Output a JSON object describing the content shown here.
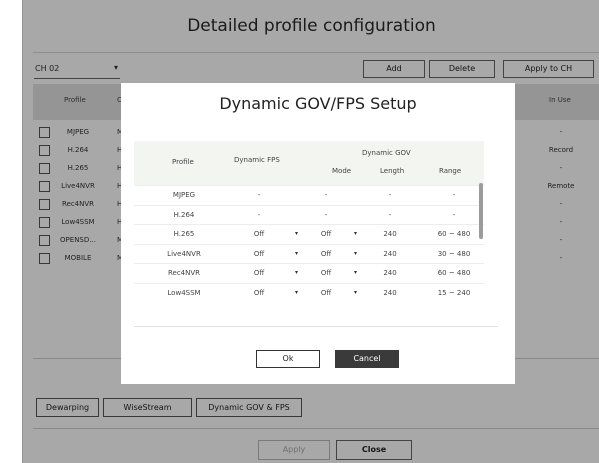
{
  "page": {
    "title": "Detailed profile configuration",
    "channel_select": {
      "value": "CH 02",
      "caret": "▾"
    },
    "toolbar": {
      "add": "Add",
      "delete": "Delete",
      "apply_to_ch": "Apply to CH"
    },
    "table": {
      "headers": {
        "profile": "Profile",
        "codec": "Co",
        "in_use": "In Use"
      },
      "rows": [
        {
          "profile": "MJPEG",
          "codec": "MJ",
          "in_use": "-"
        },
        {
          "profile": "H.264",
          "codec": "H.",
          "in_use": "Record"
        },
        {
          "profile": "H.265",
          "codec": "H.",
          "in_use": "-"
        },
        {
          "profile": "Live4NVR",
          "codec": "H.",
          "in_use": "Remote"
        },
        {
          "profile": "Rec4NVR",
          "codec": "H.",
          "in_use": "-"
        },
        {
          "profile": "Low4SSM",
          "codec": "H.",
          "in_use": "-"
        },
        {
          "profile": "OPENSD...",
          "codec": "MJ",
          "in_use": "-"
        },
        {
          "profile": "MOBILE",
          "codec": "MJ",
          "in_use": "-"
        }
      ]
    },
    "tabs": {
      "dewarping": "Dewarping",
      "wisestream": "WiseStream",
      "dynamic_gov_fps": "Dynamic GOV & FPS"
    },
    "footer": {
      "apply": "Apply",
      "close": "Close"
    }
  },
  "dialog": {
    "title": "Dynamic GOV/FPS Setup",
    "headers": {
      "profile": "Profile",
      "dynamic_fps": "Dynamic FPS",
      "dynamic_gov": "Dynamic GOV",
      "mode": "Mode",
      "length": "Length",
      "range": "Range"
    },
    "dropdown_caret": "▾",
    "rows": [
      {
        "profile": "MJPEG",
        "fps": "-",
        "mode": "-",
        "length": "-",
        "range": "-"
      },
      {
        "profile": "H.264",
        "fps": "-",
        "mode": "-",
        "length": "-",
        "range": "-"
      },
      {
        "profile": "H.265",
        "fps": "Off",
        "mode": "Off",
        "length": "240",
        "range": "60 ~ 480"
      },
      {
        "profile": "Live4NVR",
        "fps": "Off",
        "mode": "Off",
        "length": "240",
        "range": "30 ~ 480"
      },
      {
        "profile": "Rec4NVR",
        "fps": "Off",
        "mode": "Off",
        "length": "240",
        "range": "60 ~ 480"
      },
      {
        "profile": "Low4SSM",
        "fps": "Off",
        "mode": "Off",
        "length": "240",
        "range": "15 ~ 240"
      }
    ],
    "ok": "Ok",
    "cancel": "Cancel"
  }
}
